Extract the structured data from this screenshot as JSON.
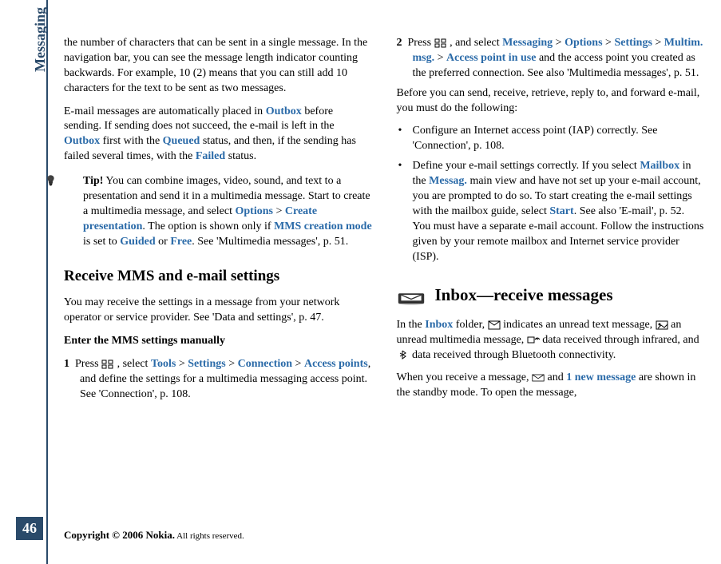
{
  "sidebar": {
    "label": "Messaging",
    "page_number": "46"
  },
  "col1": {
    "p1": "the number of characters that can be sent in a single message. In the navigation bar, you can see the message length indicator counting backwards. For example, 10 (2) means that you can still add 10 characters for the text to be sent as two messages.",
    "p2_a": "E-mail messages are automatically placed in ",
    "p2_outbox1": "Outbox",
    "p2_b": " before sending. If sending does not succeed, the e-mail is left in the ",
    "p2_outbox2": "Outbox",
    "p2_c": " first with the ",
    "p2_queued": "Queued",
    "p2_d": " status, and then, if the sending has failed several times, with the ",
    "p2_failed": "Failed",
    "p2_e": " status.",
    "tip_label": "Tip!",
    "tip_a": " You can combine images, video, sound, and text to a presentation and send it in a multimedia message. Start to create a multimedia message, and select ",
    "tip_options": "Options",
    "tip_gt1": " > ",
    "tip_create": "Create presentation",
    "tip_b": ". The option is shown only if ",
    "tip_mms": "MMS creation mode",
    "tip_c": " is set to ",
    "tip_guided": "Guided",
    "tip_d": " or ",
    "tip_free": "Free",
    "tip_e": ". See 'Multimedia messages', p. 51.",
    "h2": "Receive MMS and e-mail settings",
    "p3": "You may receive the settings in a message from your network operator or service provider. See 'Data and settings', p. 47.",
    "p4_bold": "Enter the MMS settings manually",
    "s1_num": "1",
    "s1_a": "Press ",
    "s1_b": " , select ",
    "s1_tools": "Tools",
    "s1_gt1": " > ",
    "s1_settings": "Settings",
    "s1_gt2": " > ",
    "s1_conn": "Connection",
    "s1_gt3": " > ",
    "s1_ap": "Access points",
    "s1_c": ", and define the settings for a multimedia messaging access point. See 'Connection', p. 108."
  },
  "col2": {
    "s2_num": "2",
    "s2_a": "Press ",
    "s2_b": " , and select ",
    "s2_messaging": "Messaging",
    "s2_gt1": " > ",
    "s2_options": "Options",
    "s2_gt2": " > ",
    "s2_settings": "Settings",
    "s2_gt3": " > ",
    "s2_multim": "Multim. msg.",
    "s2_gt4": " > ",
    "s2_apiu": "Access point in use",
    "s2_c": " and the access point you created as the preferred connection. See also 'Multimedia messages', p. 51.",
    "p5": "Before you can send, receive, retrieve, reply to, and forward e-mail, you must do the following:",
    "b1": "Configure an Internet access point (IAP) correctly. See 'Connection', p. 108.",
    "b2_a": "Define your e-mail settings correctly. If you select ",
    "b2_mailbox": "Mailbox",
    "b2_b": " in the ",
    "b2_messag": "Messag.",
    "b2_c": " main view and have not set up your e-mail account, you are prompted to do so. To start creating the e-mail settings with the mailbox guide, select ",
    "b2_start": "Start",
    "b2_d": ". See also 'E-mail', p. 52.",
    "b2_e": "You must have a separate e-mail account. Follow the instructions given by your remote mailbox and Internet service provider (ISP).",
    "h1": "Inbox—receive messages",
    "p6_a": "In the ",
    "p6_inbox": "Inbox",
    "p6_b": " folder, ",
    "p6_c": " indicates an unread text message, ",
    "p6_d": " an unread multimedia message, ",
    "p6_e": " data received through infrared, and ",
    "p6_f": " data received through Bluetooth connectivity.",
    "p7_a": "When you receive a message, ",
    "p7_b": " and ",
    "p7_newmsg": "1 new message",
    "p7_c": " are shown in the standby mode. To open the message,"
  },
  "footer": {
    "copyright": "Copyright © 2006 Nokia.",
    "rights": " All rights reserved."
  }
}
